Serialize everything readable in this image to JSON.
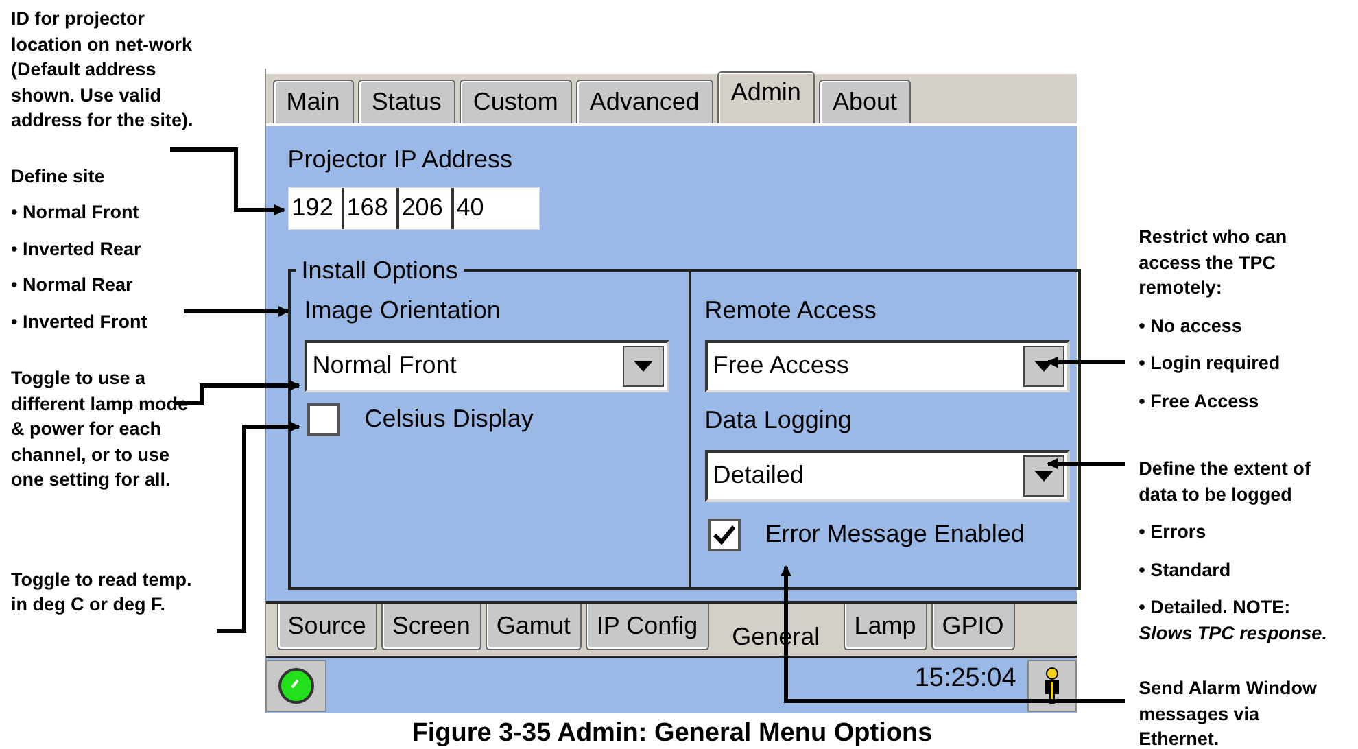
{
  "left_notes": [
    {
      "kind": "para",
      "text": "ID for projector location on net-work (Default address shown. Use valid address for the site)."
    },
    {
      "kind": "list",
      "title": "Define site",
      "items": [
        "• Normal Front",
        "• Inverted Rear",
        "• Normal Rear",
        "• Inverted Front"
      ]
    },
    {
      "kind": "para",
      "text": "Toggle to use a different lamp mode & power for each channel, or to use one setting for all."
    },
    {
      "kind": "para",
      "text": "Toggle to read temp. in deg C or deg F."
    }
  ],
  "screen": {
    "top_tabs": [
      {
        "label": "Main",
        "selected": false
      },
      {
        "label": "Status",
        "selected": false
      },
      {
        "label": "Custom",
        "selected": false
      },
      {
        "label": "Advanced",
        "selected": false
      },
      {
        "label": "Admin",
        "selected": true
      },
      {
        "label": "About",
        "selected": false
      }
    ],
    "ip": {
      "label": "Projector IP Address",
      "octets": [
        "192",
        "168",
        "206",
        "40"
      ]
    },
    "install_options": {
      "title": "Install Options",
      "image_orientation": {
        "label": "Image Orientation",
        "value": "Normal Front"
      },
      "celsius": {
        "label": "Celsius Display",
        "checked": false
      },
      "remote_access": {
        "label": "Remote Access",
        "value": "Free Access"
      },
      "data_logging": {
        "label": "Data Logging",
        "value": "Detailed"
      },
      "error_message": {
        "label": "Error Message Enabled",
        "checked": true
      }
    },
    "bottom_tabs": [
      {
        "label": "Source",
        "selected": false
      },
      {
        "label": "Screen",
        "selected": false
      },
      {
        "label": "Gamut",
        "selected": false
      },
      {
        "label": "IP Config",
        "selected": false
      },
      {
        "label": "General",
        "selected": true
      },
      {
        "label": "Lamp",
        "selected": false
      },
      {
        "label": "GPIO",
        "selected": false
      }
    ],
    "status_bar": {
      "time": "15:25:04"
    }
  },
  "caption": "Figure 3-35 Admin: General Menu Options",
  "right_notes": [
    {
      "kind": "list",
      "title": "Restrict who can access the TPC remotely:",
      "items": [
        "• No access",
        "• Login required",
        "• Free Access"
      ]
    },
    {
      "kind": "list",
      "title": "Define the extent of data to be logged",
      "items": [
        "• Errors",
        "• Standard",
        "• Detailed. NOTE: *Slows TPC response.*"
      ]
    },
    {
      "kind": "para",
      "text": "Send Alarm Window messages via Ethernet."
    }
  ]
}
